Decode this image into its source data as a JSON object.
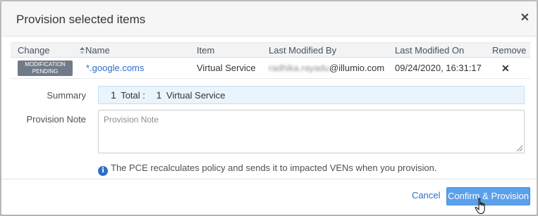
{
  "dialog": {
    "title": "Provision selected items",
    "close_icon": "close-icon"
  },
  "table": {
    "columns": [
      "Change",
      "Name",
      "Item",
      "Last Modified By",
      "Last Modified On",
      "Remove"
    ],
    "sort_icon": "sort-icon",
    "rows": [
      {
        "change_badge": [
          "MODIFICATION",
          "PENDING"
        ],
        "name": "*.google.coms",
        "item": "Virtual Service",
        "modified_by_redacted": "radhika.rayadu",
        "modified_by_domain": "@illumio.com",
        "modified_on": "09/24/2020, 16:31:17",
        "remove_icon": "remove-icon"
      }
    ]
  },
  "summary": {
    "label": "Summary",
    "total_count": "1",
    "total_label": "Total :",
    "item_count": "1",
    "item_label": "Virtual Service"
  },
  "note": {
    "label": "Provision Note",
    "placeholder": "Provision Note",
    "value": ""
  },
  "info": {
    "icon": "info-icon",
    "text": "The PCE recalculates policy and sends it to impacted VENs when you provision."
  },
  "footer": {
    "cancel_label": "Cancel",
    "confirm_label": "Confirm & Provision"
  },
  "colors": {
    "accent": "#2d6dcc",
    "primary_button": "#5aa0ea",
    "badge": "#6f7b87",
    "summary_bg": "#eaf4fc"
  }
}
